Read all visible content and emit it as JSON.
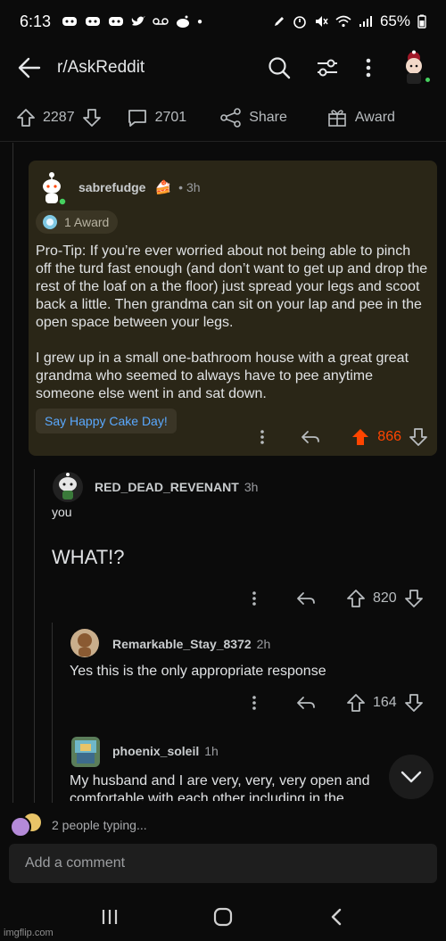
{
  "status_bar": {
    "time": "6:13",
    "battery": "65%"
  },
  "header": {
    "subreddit": "r/AskReddit"
  },
  "post_actions": {
    "upvotes": "2287",
    "comments": "2701",
    "share": "Share",
    "award": "Award"
  },
  "comments": [
    {
      "username": "sabrefudge",
      "time": "• 3h",
      "award": "1 Award",
      "body": "Pro-Tip:  If you’re ever worried about not being able to pinch off the turd fast enough (and don’t want to get up and drop the rest of the loaf on a the floor) just spread your legs and scoot back a little.  Then grandma can sit on your lap and pee in the open space between your legs.\n\nI grew up in a small one-bathroom house with a great great grandma who seemed to always have to pee anytime someone else went in and sat down.",
      "cake_button": "Say Happy Cake Day!",
      "score": "866",
      "score_color": "#ff4500"
    },
    {
      "username": "RED_DEAD_REVENANT",
      "time": "3h",
      "body_line1": "you",
      "body_line2": "WHAT!?",
      "score": "820"
    },
    {
      "username": "Remarkable_Stay_8372",
      "time": "2h",
      "body": "Yes this is the only appropriate response",
      "score": "164"
    },
    {
      "username": "phoenix_soleil",
      "time": "1h",
      "body": "My husband and I are very, very, very open and comfortable with each other including in the"
    }
  ],
  "typing_indicator": "2 people typing...",
  "compose": {
    "placeholder": "Add a comment"
  },
  "watermark": "imgflip.com",
  "colors": {
    "background": "#0b0b0b",
    "highlight_card": "#2a2617",
    "upvoted": "#ff4500",
    "link": "#5aa9ff"
  }
}
